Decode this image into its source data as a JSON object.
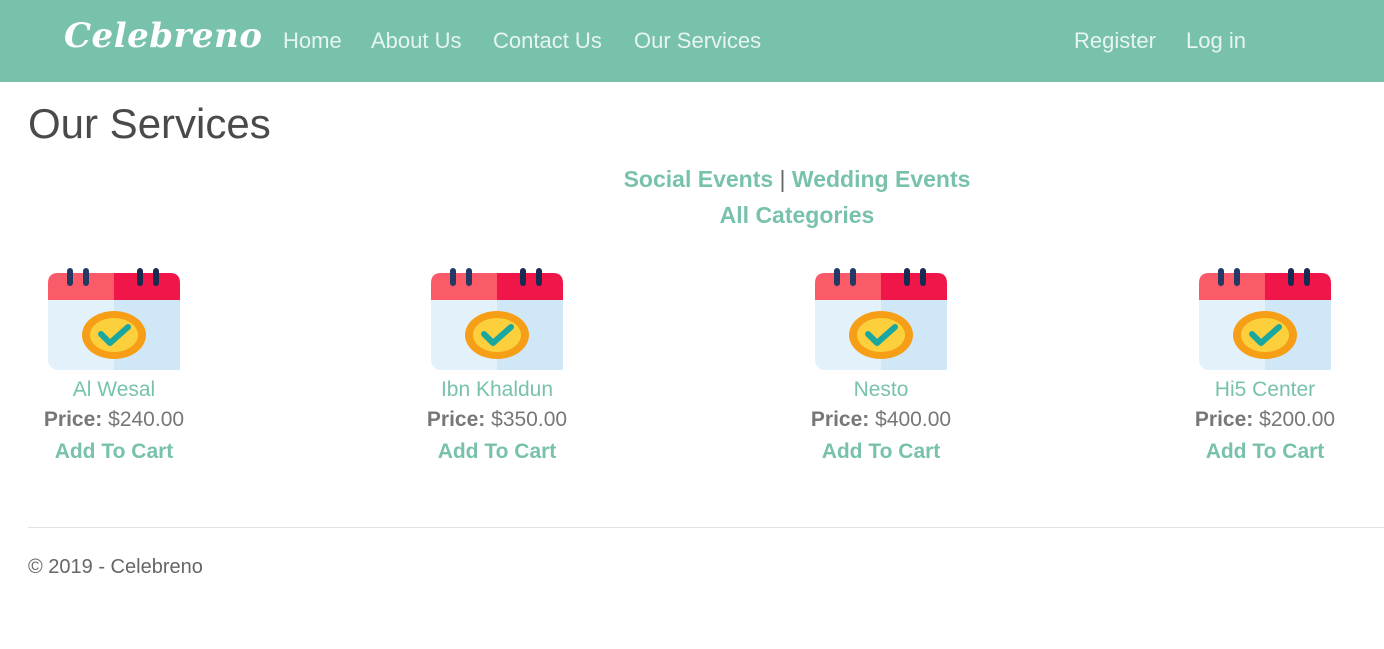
{
  "nav": {
    "brand": "Celebreno",
    "links": [
      "Home",
      "About Us",
      "Contact Us",
      "Our Services"
    ],
    "auth": [
      "Register",
      "Log in"
    ]
  },
  "main": {
    "title": "Our Services",
    "categories": {
      "social": "Social Events",
      "separator": "|",
      "wedding": "Wedding Events",
      "all": "All Categories"
    },
    "products": [
      {
        "name": "Al Wesal",
        "price_label": "Price:",
        "price": "$240.00",
        "cart_label": "Add To Cart",
        "icon": "calendar-check-icon"
      },
      {
        "name": "Ibn Khaldun",
        "price_label": "Price:",
        "price": "$350.00",
        "cart_label": "Add To Cart",
        "icon": "calendar-check-icon"
      },
      {
        "name": "Nesto",
        "price_label": "Price:",
        "price": "$400.00",
        "cart_label": "Add To Cart",
        "icon": "calendar-check-icon"
      },
      {
        "name": "Hi5 Center",
        "price_label": "Price:",
        "price": "$200.00",
        "cart_label": "Add To Cart",
        "icon": "calendar-check-icon"
      }
    ]
  },
  "footer": {
    "text": "© 2019 - Celebreno"
  },
  "colors": {
    "primary": "#78c2ad",
    "text": "#555555"
  }
}
